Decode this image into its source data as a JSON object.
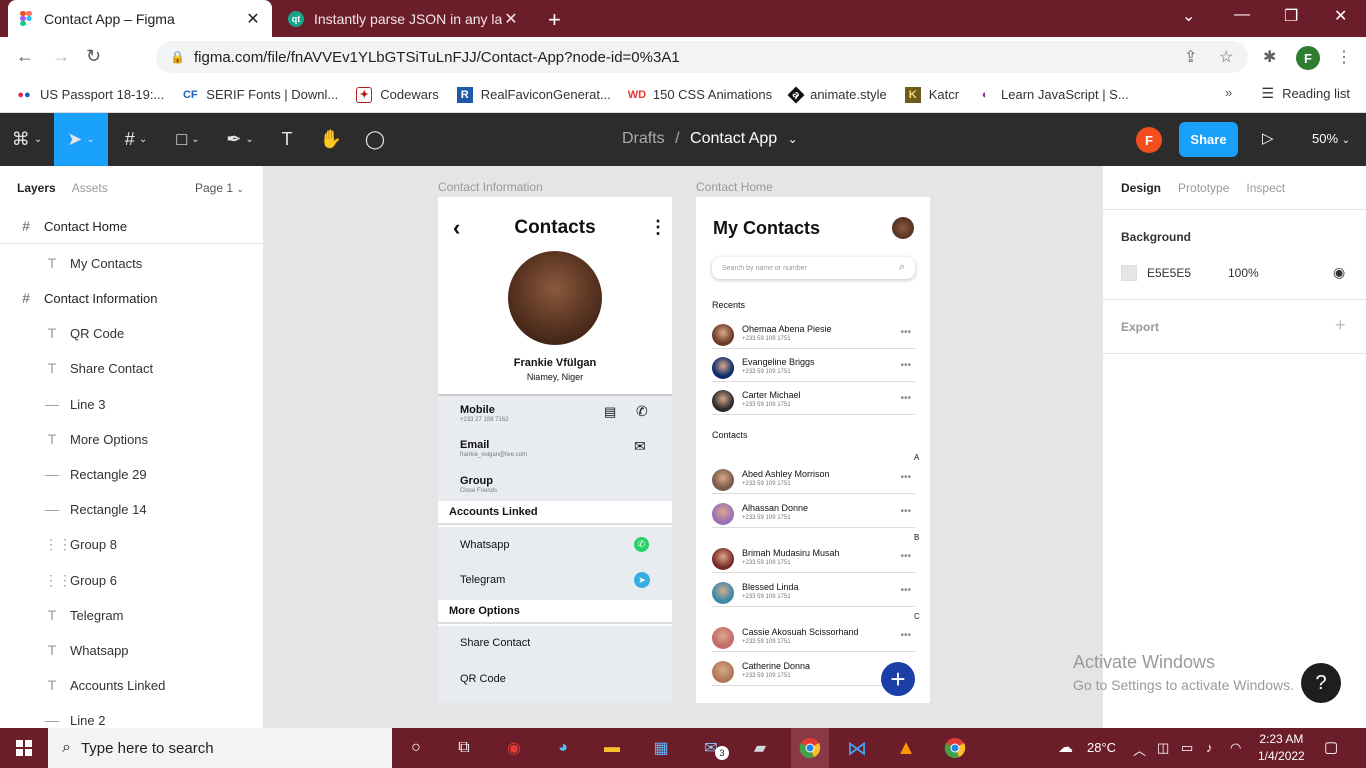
{
  "browser": {
    "tabs": [
      {
        "title": "Contact App – Figma",
        "close": "✕"
      },
      {
        "title": "Instantly parse JSON in any langu",
        "close": "✕"
      }
    ],
    "url": "figma.com/file/fnAVVEv1YLbGTSiTuLnFJJ/Contact-App?node-id=0%3A1",
    "profile_initial": "F",
    "bookmarks": [
      {
        "label": "US Passport 18-19:...",
        "icon": "dots"
      },
      {
        "label": "SERIF Fonts | Downl...",
        "icon": "CF"
      },
      {
        "label": "Codewars",
        "icon": "codewars"
      },
      {
        "label": "RealFaviconGenerat...",
        "icon": "R"
      },
      {
        "label": "150 CSS Animations",
        "icon": "WD"
      },
      {
        "label": "animate.style",
        "icon": "a"
      },
      {
        "label": "Katcr",
        "icon": "K"
      },
      {
        "label": "Learn JavaScript | S...",
        "icon": "scrimba"
      }
    ],
    "reading_list": "Reading list"
  },
  "figma": {
    "breadcrumb_parent": "Drafts",
    "breadcrumb_sep": "/",
    "file_name": "Contact App",
    "user_initial": "F",
    "share_label": "Share",
    "zoom": "50%"
  },
  "left_panel": {
    "tab_layers": "Layers",
    "tab_assets": "Assets",
    "page": "Page 1",
    "layers": [
      {
        "name": "Contact Home",
        "kind": "frame"
      },
      {
        "name": "My Contacts",
        "kind": "text"
      },
      {
        "name": "Contact Information",
        "kind": "frame"
      },
      {
        "name": "QR Code",
        "kind": "text"
      },
      {
        "name": "Share Contact",
        "kind": "text"
      },
      {
        "name": "Line 3",
        "kind": "line"
      },
      {
        "name": "More Options",
        "kind": "text"
      },
      {
        "name": "Rectangle 29",
        "kind": "line"
      },
      {
        "name": "Rectangle 14",
        "kind": "line"
      },
      {
        "name": "Group 8",
        "kind": "group"
      },
      {
        "name": "Group 6",
        "kind": "group"
      },
      {
        "name": "Telegram",
        "kind": "text"
      },
      {
        "name": "Whatsapp",
        "kind": "text"
      },
      {
        "name": "Accounts Linked",
        "kind": "text"
      },
      {
        "name": "Line 2",
        "kind": "line"
      }
    ]
  },
  "canvas": {
    "contact_info": {
      "frame_label": "Contact Information",
      "title": "Contacts",
      "name": "Frankie Vfülgan",
      "location": "Niamey, Niger",
      "mobile_label": "Mobile",
      "mobile_value": "+233 27 188 7162",
      "email_label": "Email",
      "email_value": "frankie_vulgan@live.com",
      "group_label": "Group",
      "group_value": "Close Friends",
      "accounts_head": "Accounts Linked",
      "whatsapp": "Whatsapp",
      "telegram": "Telegram",
      "more_head": "More Options",
      "share_contact": "Share Contact",
      "qr_code": "QR Code"
    },
    "contact_home": {
      "frame_label": "Contact Home",
      "title": "My Contacts",
      "search_placeholder": "Search by name or number",
      "recents_label": "Recents",
      "contacts_label": "Contacts",
      "recents": [
        {
          "name": "Ohemaa Abena Piesie",
          "number": "+233 59 109 1751"
        },
        {
          "name": "Evangeline Briggs",
          "number": "+233 59 109 1751"
        },
        {
          "name": "Carter Michael",
          "number": "+233 59 109 1751"
        }
      ],
      "letters": [
        "A",
        "B",
        "C"
      ],
      "contacts": [
        {
          "name": "Abed Ashley Morrison",
          "number": "+233 59 109 1751"
        },
        {
          "name": "Alhassan Donne",
          "number": "+233 59 109 1751"
        },
        {
          "name": "Brimah Mudasiru Musah",
          "number": "+233 59 109 1751"
        },
        {
          "name": "Blessed Linda",
          "number": "+233 59 109 1751"
        },
        {
          "name": "Cassie Akosuah Scissorhand",
          "number": "+233 59 109 1751"
        },
        {
          "name": "Catherine Donna",
          "number": "+233 59 109 1751"
        }
      ],
      "more_dots": "•••",
      "fab_label": "+"
    }
  },
  "right_panel": {
    "tab_design": "Design",
    "tab_prototype": "Prototype",
    "tab_inspect": "Inspect",
    "background_label": "Background",
    "bg_hex": "E5E5E5",
    "bg_opacity": "100%",
    "export_label": "Export",
    "add": "+"
  },
  "watermark": {
    "line1": "Activate Windows",
    "line2": "Go to Settings to activate Windows."
  },
  "help_label": "?",
  "taskbar": {
    "search_placeholder": "Type here to search",
    "temperature": "28°C",
    "time": "2:23 AM",
    "date": "1/4/2022",
    "mail_badge": "3"
  }
}
